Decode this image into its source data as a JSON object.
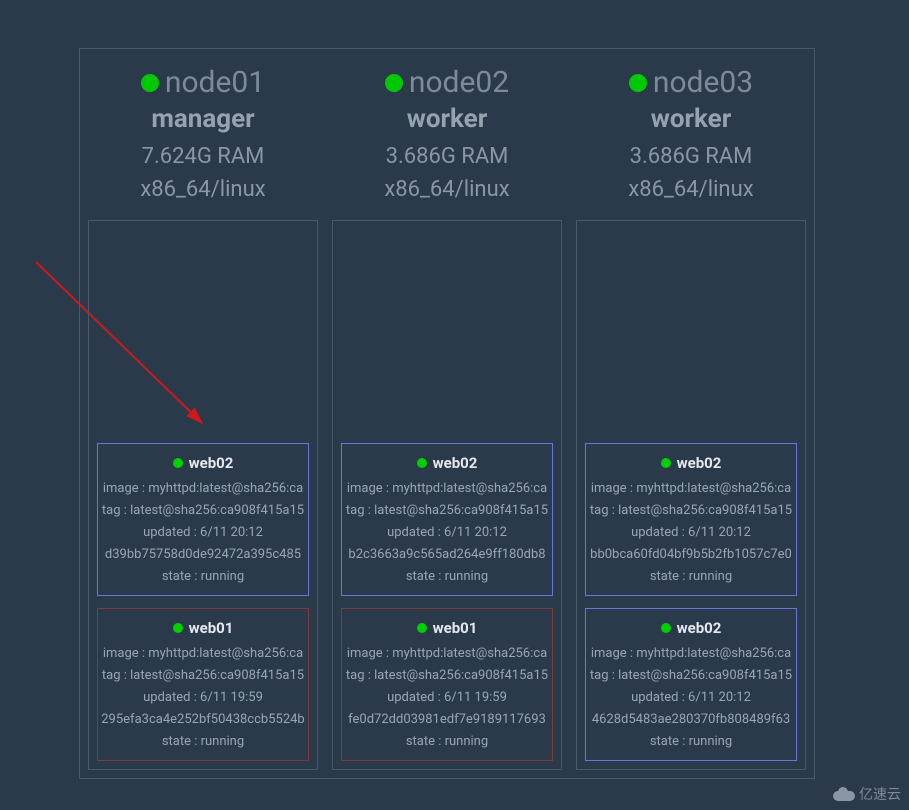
{
  "watermark": "亿速云",
  "nodes": [
    {
      "name": "node01",
      "role": "manager",
      "ram": "7.624G RAM",
      "arch": "x86_64/linux",
      "tasks": [
        {
          "name": "web02",
          "variant": "normal",
          "image": "image : myhttpd:latest@sha256:ca",
          "tag": "tag : latest@sha256:ca908f415a15",
          "updated": "updated : 6/11 20:12",
          "id": "d39bb75758d0de92472a395c485",
          "state": "state : running"
        },
        {
          "name": "web01",
          "variant": "red",
          "image": "image : myhttpd:latest@sha256:ca",
          "tag": "tag : latest@sha256:ca908f415a15",
          "updated": "updated : 6/11 19:59",
          "id": "295efa3ca4e252bf50438ccb5524b",
          "state": "state : running"
        }
      ]
    },
    {
      "name": "node02",
      "role": "worker",
      "ram": "3.686G RAM",
      "arch": "x86_64/linux",
      "tasks": [
        {
          "name": "web02",
          "variant": "normal",
          "image": "image : myhttpd:latest@sha256:ca",
          "tag": "tag : latest@sha256:ca908f415a15",
          "updated": "updated : 6/11 20:12",
          "id": "b2c3663a9c565ad264e9ff180db8",
          "state": "state : running"
        },
        {
          "name": "web01",
          "variant": "red",
          "image": "image : myhttpd:latest@sha256:ca",
          "tag": "tag : latest@sha256:ca908f415a15",
          "updated": "updated : 6/11 19:59",
          "id": "fe0d72dd03981edf7e9189117693",
          "state": "state : running"
        }
      ]
    },
    {
      "name": "node03",
      "role": "worker",
      "ram": "3.686G RAM",
      "arch": "x86_64/linux",
      "tasks": [
        {
          "name": "web02",
          "variant": "normal",
          "image": "image : myhttpd:latest@sha256:ca",
          "tag": "tag : latest@sha256:ca908f415a15",
          "updated": "updated : 6/11 20:12",
          "id": "bb0bca60fd04bf9b5b2fb1057c7e0",
          "state": "state : running"
        },
        {
          "name": "web02",
          "variant": "normal",
          "image": "image : myhttpd:latest@sha256:ca",
          "tag": "tag : latest@sha256:ca908f415a15",
          "updated": "updated : 6/11 20:12",
          "id": "4628d5483ae280370fb808489f63",
          "state": "state : running"
        }
      ]
    }
  ]
}
